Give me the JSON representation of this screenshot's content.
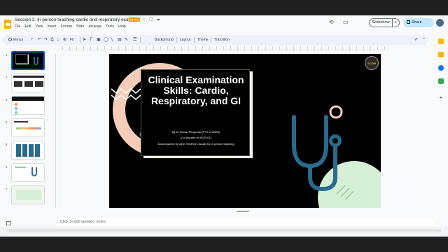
{
  "document": {
    "title": "Session 2. In person teaching cardio and respiratory exams",
    "badge": "DFTG"
  },
  "menu": [
    "File",
    "Edit",
    "View",
    "Insert",
    "Format",
    "Slide",
    "Arrange",
    "Tools",
    "Help"
  ],
  "header": {
    "slideshow_label": "Slideshow",
    "share_label": "Share"
  },
  "toolbar": {
    "search_label": "Menus",
    "zoom": "Fit",
    "background_label": "Background",
    "layout_label": "Layout",
    "theme_label": "Theme",
    "transition_label": "Transition"
  },
  "filmstrip": {
    "slide_numbers": [
      "1",
      "2",
      "3",
      "4",
      "5",
      "6",
      "7"
    ]
  },
  "slide": {
    "title": "Clinical Examination Skills: Cardio, Respiratory, and GI",
    "author_line": "By Dr Ronan Fitzgerald (FY2 at WMH)",
    "cofounder_line": "(Co-founder of ISCE101)",
    "accompanied_line": "Accompanied by other ISCE101 faculty for in person teaching",
    "logo_text": "SCOM",
    "colors": {
      "background": "#000000",
      "accent_teal": "#2b6a8a",
      "accent_peach": "#f3cdb8",
      "accent_mint": "#d6efd7",
      "card": "#f4f0e8"
    }
  },
  "notes": {
    "placeholder": "Click to add speaker notes"
  },
  "icons": [
    "slides-logo",
    "star-icon",
    "move-icon",
    "cloud-icon",
    "history-icon",
    "camera-icon",
    "lock-icon",
    "search-icon",
    "undo-icon",
    "redo-icon",
    "print-icon",
    "paint-format-icon",
    "zoom-icon",
    "cursor-icon",
    "textbox-icon",
    "image-icon",
    "shape-icon",
    "line-icon",
    "comment-icon",
    "pen-icon",
    "collapse-icon",
    "stethoscope-icon"
  ]
}
